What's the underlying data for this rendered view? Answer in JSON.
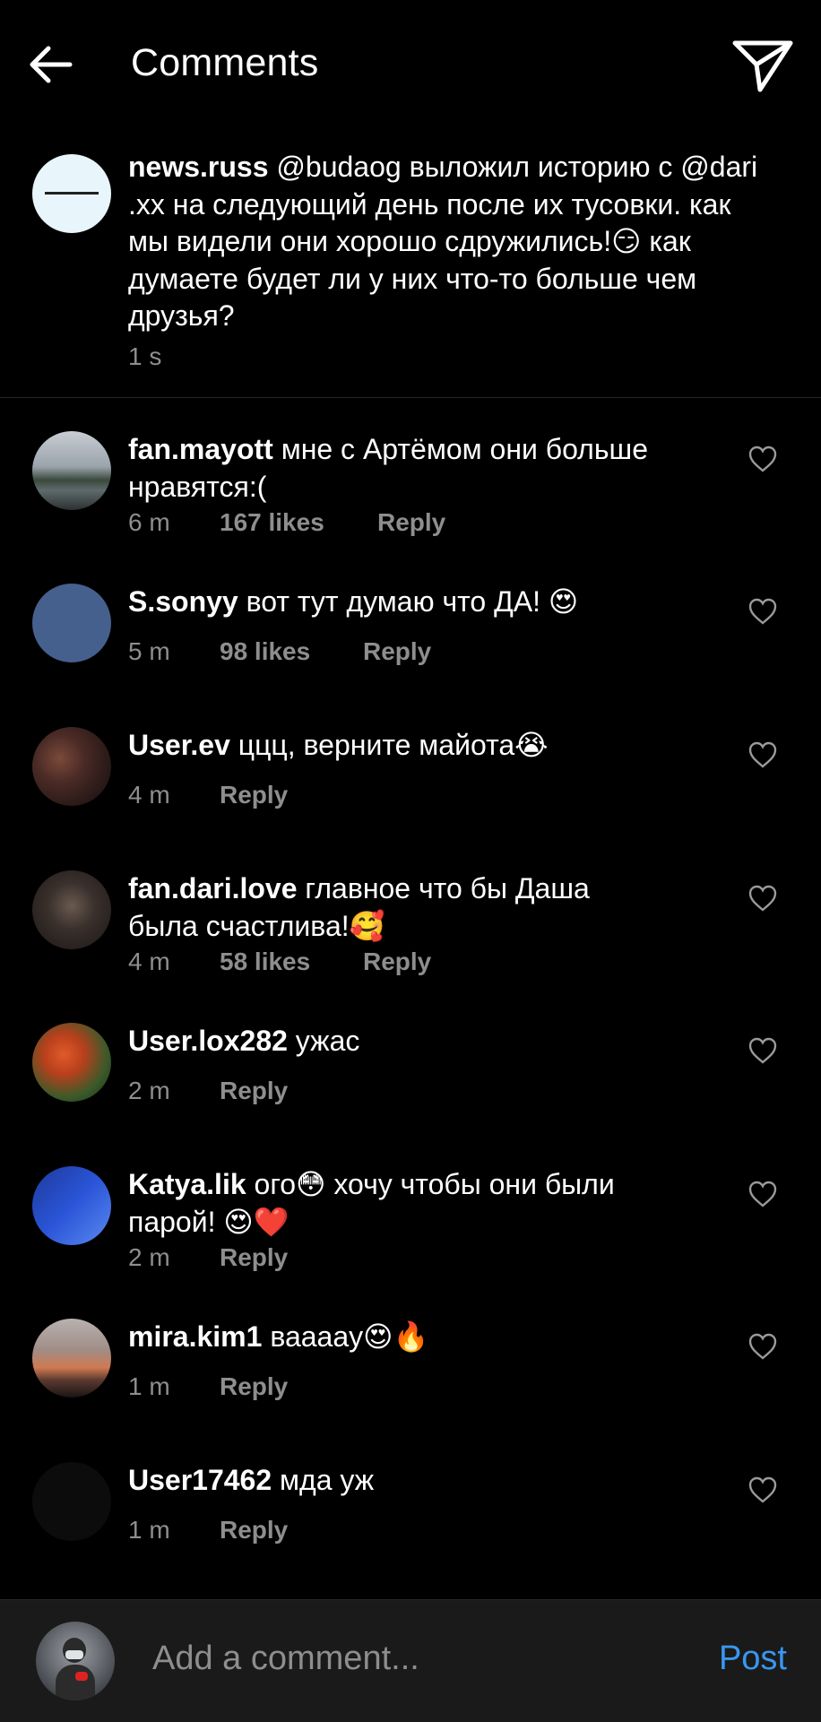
{
  "header": {
    "title": "Comments",
    "back_icon": "arrow-left-icon",
    "share_icon": "paper-plane-icon"
  },
  "caption": {
    "username": "news.russ",
    "text_lines": [
      " @budaog выложил историю с @dari",
      ".xx на следующий день после их тусовки. как",
      "мы видели они хорошо сдружились!😏 как",
      "думаете будет ли у них что-то больше чем",
      "друзья?"
    ],
    "time": "1 s"
  },
  "comments": [
    {
      "username": "fan.mayott",
      "text_lines": [
        " мне с Артёмом они больше",
        "нравятся:("
      ],
      "time": "6 m",
      "likes": "167 likes",
      "reply": "Reply"
    },
    {
      "username": "S.sonyy",
      "text_lines": [
        " вот тут думаю что ДА! 😍"
      ],
      "time": "5 m",
      "likes": "98 likes",
      "reply": "Reply"
    },
    {
      "username": "User.ev",
      "text_lines": [
        " ццц, верните майота😭"
      ],
      "time": "4 m",
      "likes": "",
      "reply": "Reply"
    },
    {
      "username": "fan.dari.love",
      "text_lines": [
        " главное что бы Даша",
        "была счастлива!🥰"
      ],
      "time": "4 m",
      "likes": "58 likes",
      "reply": "Reply"
    },
    {
      "username": "User.lox282",
      "text_lines": [
        " ужас"
      ],
      "time": "2 m",
      "likes": "",
      "reply": "Reply"
    },
    {
      "username": "Katya.lik",
      "text_lines": [
        " ого😳 хочу чтобы они были",
        "парой! 😍❤️"
      ],
      "time": "2 m",
      "likes": "",
      "reply": "Reply"
    },
    {
      "username": "mira.kim1",
      "text_lines": [
        " вааааy😍🔥"
      ],
      "time": "1 m",
      "likes": "",
      "reply": "Reply"
    },
    {
      "username": "User17462",
      "text_lines": [
        " мда уж"
      ],
      "time": "1 m",
      "likes": "",
      "reply": "Reply"
    }
  ],
  "bottom": {
    "placeholder": "Add a comment...",
    "post_label": "Post"
  },
  "colors": {
    "background": "#000000",
    "secondary_text": "#8e8e8e",
    "accent": "#3897f0"
  }
}
